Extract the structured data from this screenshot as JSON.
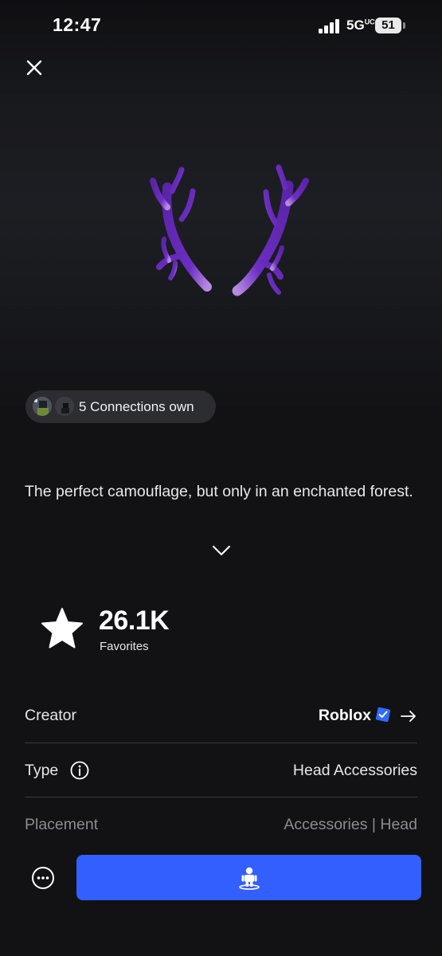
{
  "status_bar": {
    "time": "12:47",
    "network": "5G",
    "network_suffix": "UC",
    "battery": "51"
  },
  "icons": {
    "close": "close-icon",
    "expand": "chevron-down-icon",
    "favorite": "star-icon",
    "verified": "verified-badge-icon",
    "creator_link": "arrow-right-icon",
    "info": "info-icon",
    "more": "more-options-icon",
    "try_on": "avatar-try-on-icon"
  },
  "item": {
    "image_alt": "purple antlers",
    "connections_label": "5 Connections own",
    "description": "The perfect camouflage, but only in an enchanted forest."
  },
  "favorites": {
    "count": "26.1K",
    "label": "Favorites"
  },
  "details": {
    "creator_label": "Creator",
    "creator_value": "Roblox",
    "type_label": "Type",
    "type_value": "Head Accessories",
    "placement_label": "Placement",
    "placement_value": "Accessories | Head"
  },
  "colors": {
    "background": "#121215",
    "accent": "#335fff",
    "verified": "#2f6bff",
    "antler": "#6a2dbd"
  }
}
